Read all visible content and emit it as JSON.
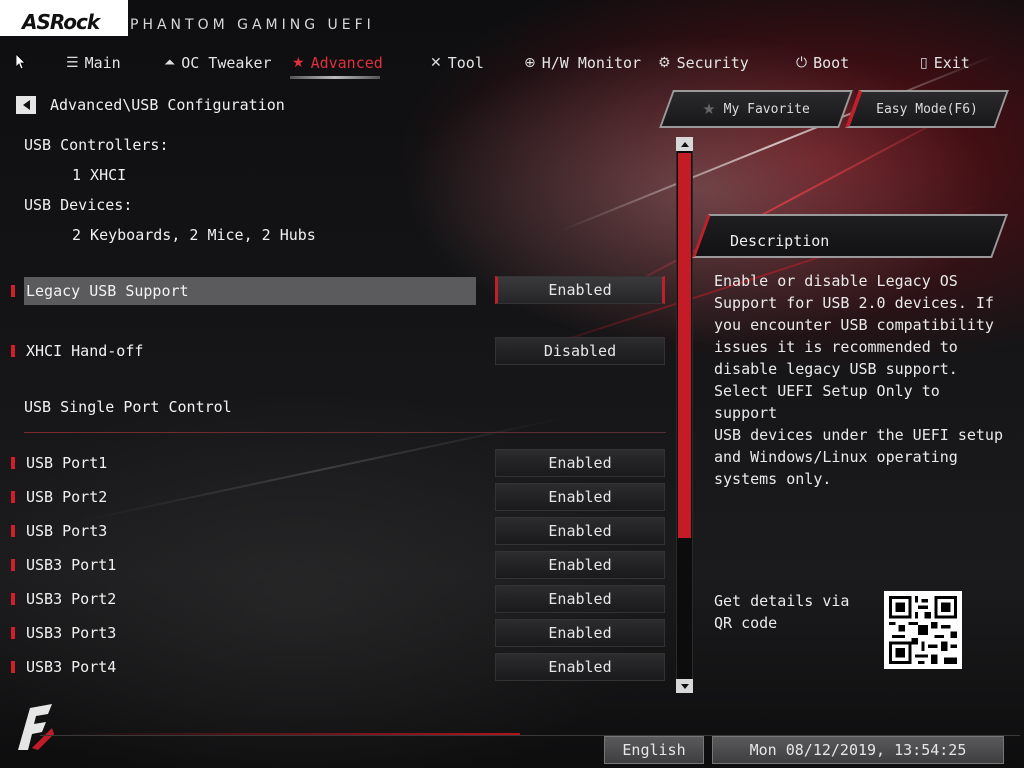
{
  "header": {
    "logo": "ASRock",
    "brand": "PHANTOM GAMING UEFI"
  },
  "tabs": [
    {
      "label": "Main",
      "icon": "list-icon"
    },
    {
      "label": "OC Tweaker",
      "icon": "rocket-icon"
    },
    {
      "label": "Advanced",
      "icon": "star-icon"
    },
    {
      "label": "Tool",
      "icon": "tools-icon"
    },
    {
      "label": "H/W Monitor",
      "icon": "monitor-icon"
    },
    {
      "label": "Security",
      "icon": "shield-icon"
    },
    {
      "label": "Boot",
      "icon": "power-icon"
    },
    {
      "label": "Exit",
      "icon": "exit-icon"
    }
  ],
  "active_tab": "Advanced",
  "breadcrumb": "Advanced\\USB Configuration",
  "top_buttons": {
    "favorite": "My Favorite",
    "easy_mode": "Easy Mode(F6)"
  },
  "info": {
    "controllers_label": "USB Controllers:",
    "controllers_value": "1 XHCI",
    "devices_label": "USB Devices:",
    "devices_value": "2 Keyboards, 2 Mice, 2 Hubs"
  },
  "settings": [
    {
      "label": "Legacy USB Support",
      "value": "Enabled"
    },
    {
      "label": "XHCI Hand-off",
      "value": "Disabled"
    }
  ],
  "section_label": "USB Single Port Control",
  "ports": [
    {
      "label": "USB Port1",
      "value": "Enabled"
    },
    {
      "label": "USB Port2",
      "value": "Enabled"
    },
    {
      "label": "USB Port3",
      "value": "Enabled"
    },
    {
      "label": "USB3 Port1",
      "value": "Enabled"
    },
    {
      "label": "USB3 Port2",
      "value": "Enabled"
    },
    {
      "label": "USB3 Port3",
      "value": "Enabled"
    },
    {
      "label": "USB3 Port4",
      "value": "Enabled"
    }
  ],
  "description": {
    "title": "Description",
    "body": "Enable or disable Legacy OS\nSupport for USB 2.0 devices. If\nyou encounter USB compatibility\nissues it is recommended to\ndisable legacy USB support.\nSelect UEFI Setup Only to support\nUSB devices under the UEFI setup\nand Windows/Linux operating\nsystems only."
  },
  "qr_text": "Get details via QR code",
  "footer": {
    "language": "English",
    "datetime": "Mon 08/12/2019, 13:54:25"
  },
  "colors": {
    "accent": "#c31c26",
    "background": "#0b0b0c",
    "text": "#e8e8e8"
  }
}
